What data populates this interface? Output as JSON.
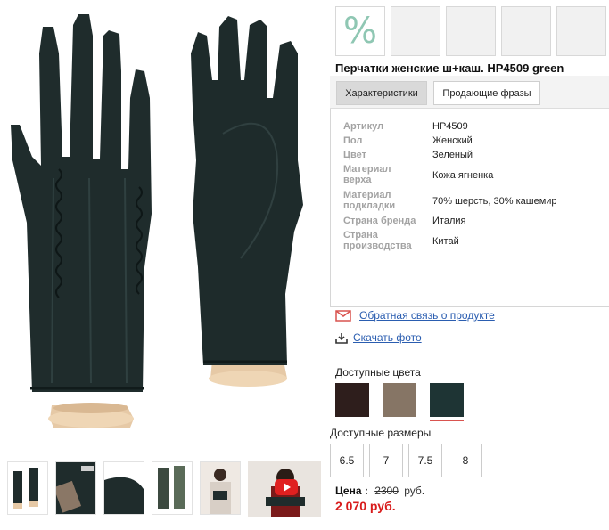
{
  "product": {
    "title": "Перчатки женские ш+каш. HP4509 green",
    "sale_badge": "%"
  },
  "tabs": [
    {
      "label": "Характеристики"
    },
    {
      "label": "Продающие фразы"
    }
  ],
  "specs": [
    {
      "label": "Артикул",
      "value": "HP4509"
    },
    {
      "label": "Пол",
      "value": "Женский"
    },
    {
      "label": "Цвет",
      "value": "Зеленый"
    },
    {
      "label": "Материал верха",
      "value": "Кожа ягненка"
    },
    {
      "label": "Материал подкладки",
      "value": "70% шерсть, 30% кашемир"
    },
    {
      "label": "Страна бренда",
      "value": "Италия"
    },
    {
      "label": "Страна производства",
      "value": "Китай"
    }
  ],
  "links": {
    "feedback": "Обратная связь о продукте",
    "download_photo": "Скачать фото"
  },
  "colors": {
    "label": "Доступные цвета",
    "swatches": [
      "#2e1e1c",
      "#867565",
      "#1e3434"
    ],
    "selected_index": 2,
    "selected_accent": "#d9534f"
  },
  "sizes": {
    "label": "Доступные размеры",
    "options": [
      "6.5",
      "7",
      "7.5",
      "8"
    ]
  },
  "price": {
    "label": "Цена :",
    "old": "2300",
    "unit": "руб.",
    "new": "2 070 руб."
  },
  "icons": {
    "feedback": "envelope-icon",
    "download": "download-icon",
    "video": "play-icon"
  }
}
